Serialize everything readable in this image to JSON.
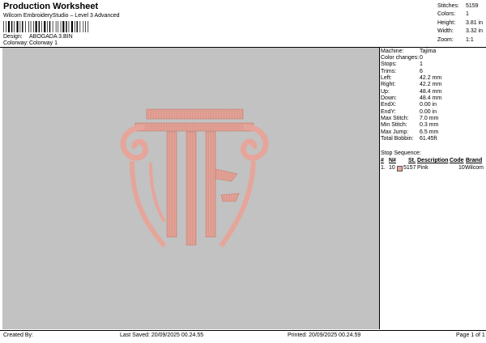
{
  "header": {
    "title": "Production Worksheet",
    "subtitle": "Wilcom EmbroideryStudio – Level 3 Advanced"
  },
  "meta": {
    "design_label": "Design:",
    "design_value": "ABOGADA 3.BIN",
    "colorway_label": "Colorway:",
    "colorway_value": "Colorway 1"
  },
  "stats": [
    {
      "label": "Stitches:",
      "value": "5159"
    },
    {
      "label": "Colors:",
      "value": "1"
    },
    {
      "label": "Height:",
      "value": "3.81 in"
    },
    {
      "label": "Width:",
      "value": "3.32 in"
    },
    {
      "label": "Zoom:",
      "value": "1:1"
    }
  ],
  "info": [
    {
      "label": "Machine:",
      "value": "Tajima"
    },
    {
      "label": "Color changes:",
      "value": "0"
    },
    {
      "label": "Stops:",
      "value": "1"
    },
    {
      "label": "Trims:",
      "value": "6"
    },
    {
      "label": "Left:",
      "value": "42.2 mm"
    },
    {
      "label": "Right:",
      "value": "42.2 mm"
    },
    {
      "label": "Up:",
      "value": "48.4 mm"
    },
    {
      "label": "Down:",
      "value": "48.4 mm"
    },
    {
      "label": "EndX:",
      "value": "0.00 in"
    },
    {
      "label": "EndY:",
      "value": "0.00 in"
    },
    {
      "label": "Max Stitch:",
      "value": "7.0 mm"
    },
    {
      "label": "Min Stitch:",
      "value": "0.3 mm"
    },
    {
      "label": "Max Jump:",
      "value": "6.5 mm"
    },
    {
      "label": "Total Bobbin:",
      "value": "61.45ft"
    }
  ],
  "sequence": {
    "title": "Stop Sequence:",
    "headers": {
      "num": "#",
      "n": "N#",
      "st": "St.",
      "description": "Description",
      "code": "Code",
      "brand": "Brand"
    },
    "rows": [
      {
        "num": "1.",
        "n": "10",
        "st": "5157",
        "description": "Pink",
        "code": "10",
        "brand": "Wilcom",
        "color": "#e6a59a"
      }
    ]
  },
  "footer": {
    "created": "Created By:",
    "last_saved": "Last Saved: 20/09/2025 00.24.55",
    "printed": "Printed: 20/09/2025 00.24.59",
    "page": "Page 1 of 1"
  },
  "colors": {
    "canvas": "#c2c2c2",
    "thread": "#e6a59a",
    "thread_shadow": "#c27f72"
  }
}
